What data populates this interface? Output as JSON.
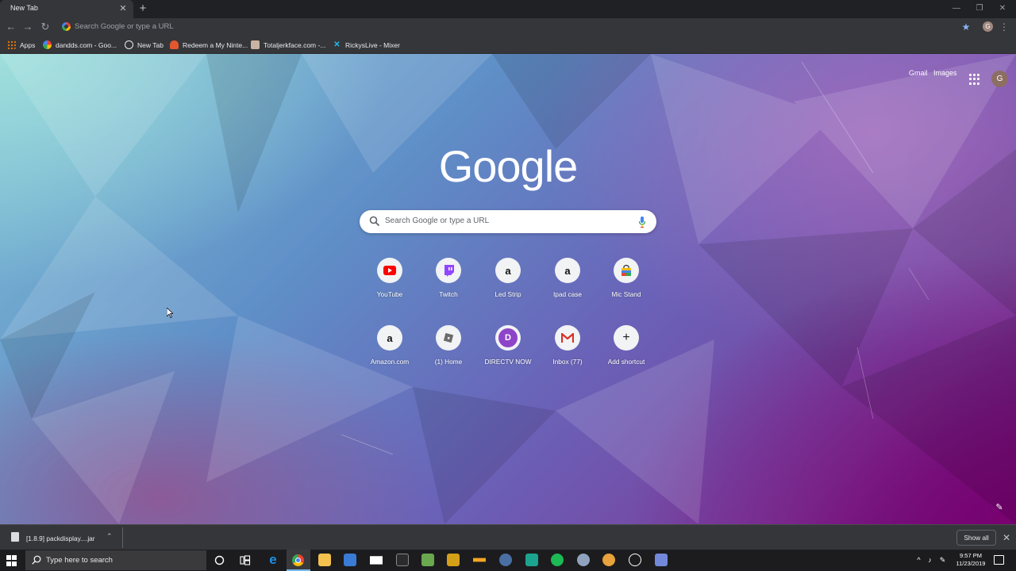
{
  "browser": {
    "tab": {
      "title": "New Tab",
      "close_glyph": "✕"
    },
    "new_tab_glyph": "+",
    "window_controls": {
      "minimize": "—",
      "restore": "❐",
      "close": "✕"
    },
    "nav": {
      "back": "←",
      "forward": "→",
      "reload": "↻"
    },
    "omnibox": {
      "placeholder": "Search Google or type a URL"
    },
    "star_glyph": "★",
    "profile_initial": "G",
    "menu_glyph": "⋮"
  },
  "bookmarks": [
    {
      "label": "Apps",
      "icon": "apps-icon",
      "color": "#e37400"
    },
    {
      "label": "dandds.com - Goo...",
      "icon": "google-icon",
      "color": "#ffffff"
    },
    {
      "label": "New Tab",
      "icon": "newtab-icon",
      "color": "#ffffff"
    },
    {
      "label": "Redeem a My Ninte...",
      "icon": "nintendo-icon",
      "color": "#e4572e"
    },
    {
      "label": "Totaljerkface.com -...",
      "icon": "site-icon",
      "color": "#c8b4a0"
    },
    {
      "label": "RickysLive - Mixer",
      "icon": "mixer-icon",
      "color": "#1fbaed"
    }
  ],
  "ntp": {
    "top_links": {
      "gmail": "Gmail",
      "images": "Images"
    },
    "avatar_initial": "G",
    "logo_text": "Google",
    "search_placeholder": "Search Google or type a URL",
    "shortcuts": [
      {
        "label": "YouTube",
        "glyph": "▶",
        "color": "#ff0000"
      },
      {
        "label": "Twitch",
        "glyph": "▣",
        "color": "#9146ff"
      },
      {
        "label": "Led Strip",
        "glyph": "a",
        "color": "#111111"
      },
      {
        "label": "Ipad case",
        "glyph": "a",
        "color": "#111111"
      },
      {
        "label": "Mic Stand",
        "glyph": "▦",
        "color": "#2d6cdf"
      },
      {
        "label": "Amazon.com",
        "glyph": "a",
        "color": "#111111"
      },
      {
        "label": "(1) Home",
        "glyph": "◆",
        "color": "#555555"
      },
      {
        "label": "DIRECTV NOW",
        "glyph": "D",
        "color": "#ffffff"
      },
      {
        "label": "Inbox (77)",
        "glyph": "M",
        "color": "#d93025"
      },
      {
        "label": "Add shortcut",
        "glyph": "+",
        "color": "#202124"
      }
    ],
    "customize_glyph": "✎"
  },
  "downloads": {
    "item": "[1.8.9] packdisplay....jar",
    "chevron": "⌃",
    "show_all": "Show all",
    "close_glyph": "✕"
  },
  "taskbar": {
    "search_placeholder": "Type here to search",
    "clock_time": "9:57 PM",
    "clock_date": "11/23/2019"
  }
}
